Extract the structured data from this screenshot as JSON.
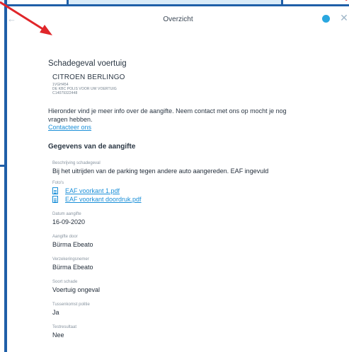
{
  "header": {
    "title": "Overzicht",
    "back_icon": "arrow-left-icon",
    "chat_icon": "chat-bubble-icon",
    "close_icon": "close-icon"
  },
  "claim": {
    "heading": "Schadegeval voertuig",
    "vehicle": {
      "name": "CITROEN BERLINGO",
      "plate": "1VGH454",
      "policy": "DE KBC POLIS VOOR UW VOERTUIG",
      "number": "C14079322448"
    },
    "intro": "Hieronder vind je meer info over de aangifte. Neem contact met ons op mocht je nog vragen hebben.",
    "contact_link": "Contacteer ons"
  },
  "details": {
    "heading": "Gegevens van de aangifte",
    "description_label": "Beschrijving schadegeval",
    "description_value": "Bij het uitrijden van de parking tegen andere auto aangereden. EAF ingevuld",
    "photos_label": "Foto's",
    "photos": [
      "EAF voorkant 1.pdf",
      "EAF voorkant doordruk.pdf"
    ],
    "date_label": "Datum aangifte",
    "date_value": "16-09-2020",
    "reported_by_label": "Aangifte door",
    "reported_by_value": "Bürma Ebeato",
    "policyholder_label": "Verzekeringsnemer",
    "policyholder_value": "Bürma Ebeato",
    "damage_type_label": "Soort schade",
    "damage_type_value": "Voertuig ongeval",
    "police_label": "Tussenkomst politie",
    "police_value": "Ja",
    "test_label": "Testresultaat",
    "test_value": "Nee"
  },
  "colors": {
    "accent": "#1a8fd8",
    "frame": "#1f5fa8",
    "annotation_arrow": "#e0262a"
  }
}
